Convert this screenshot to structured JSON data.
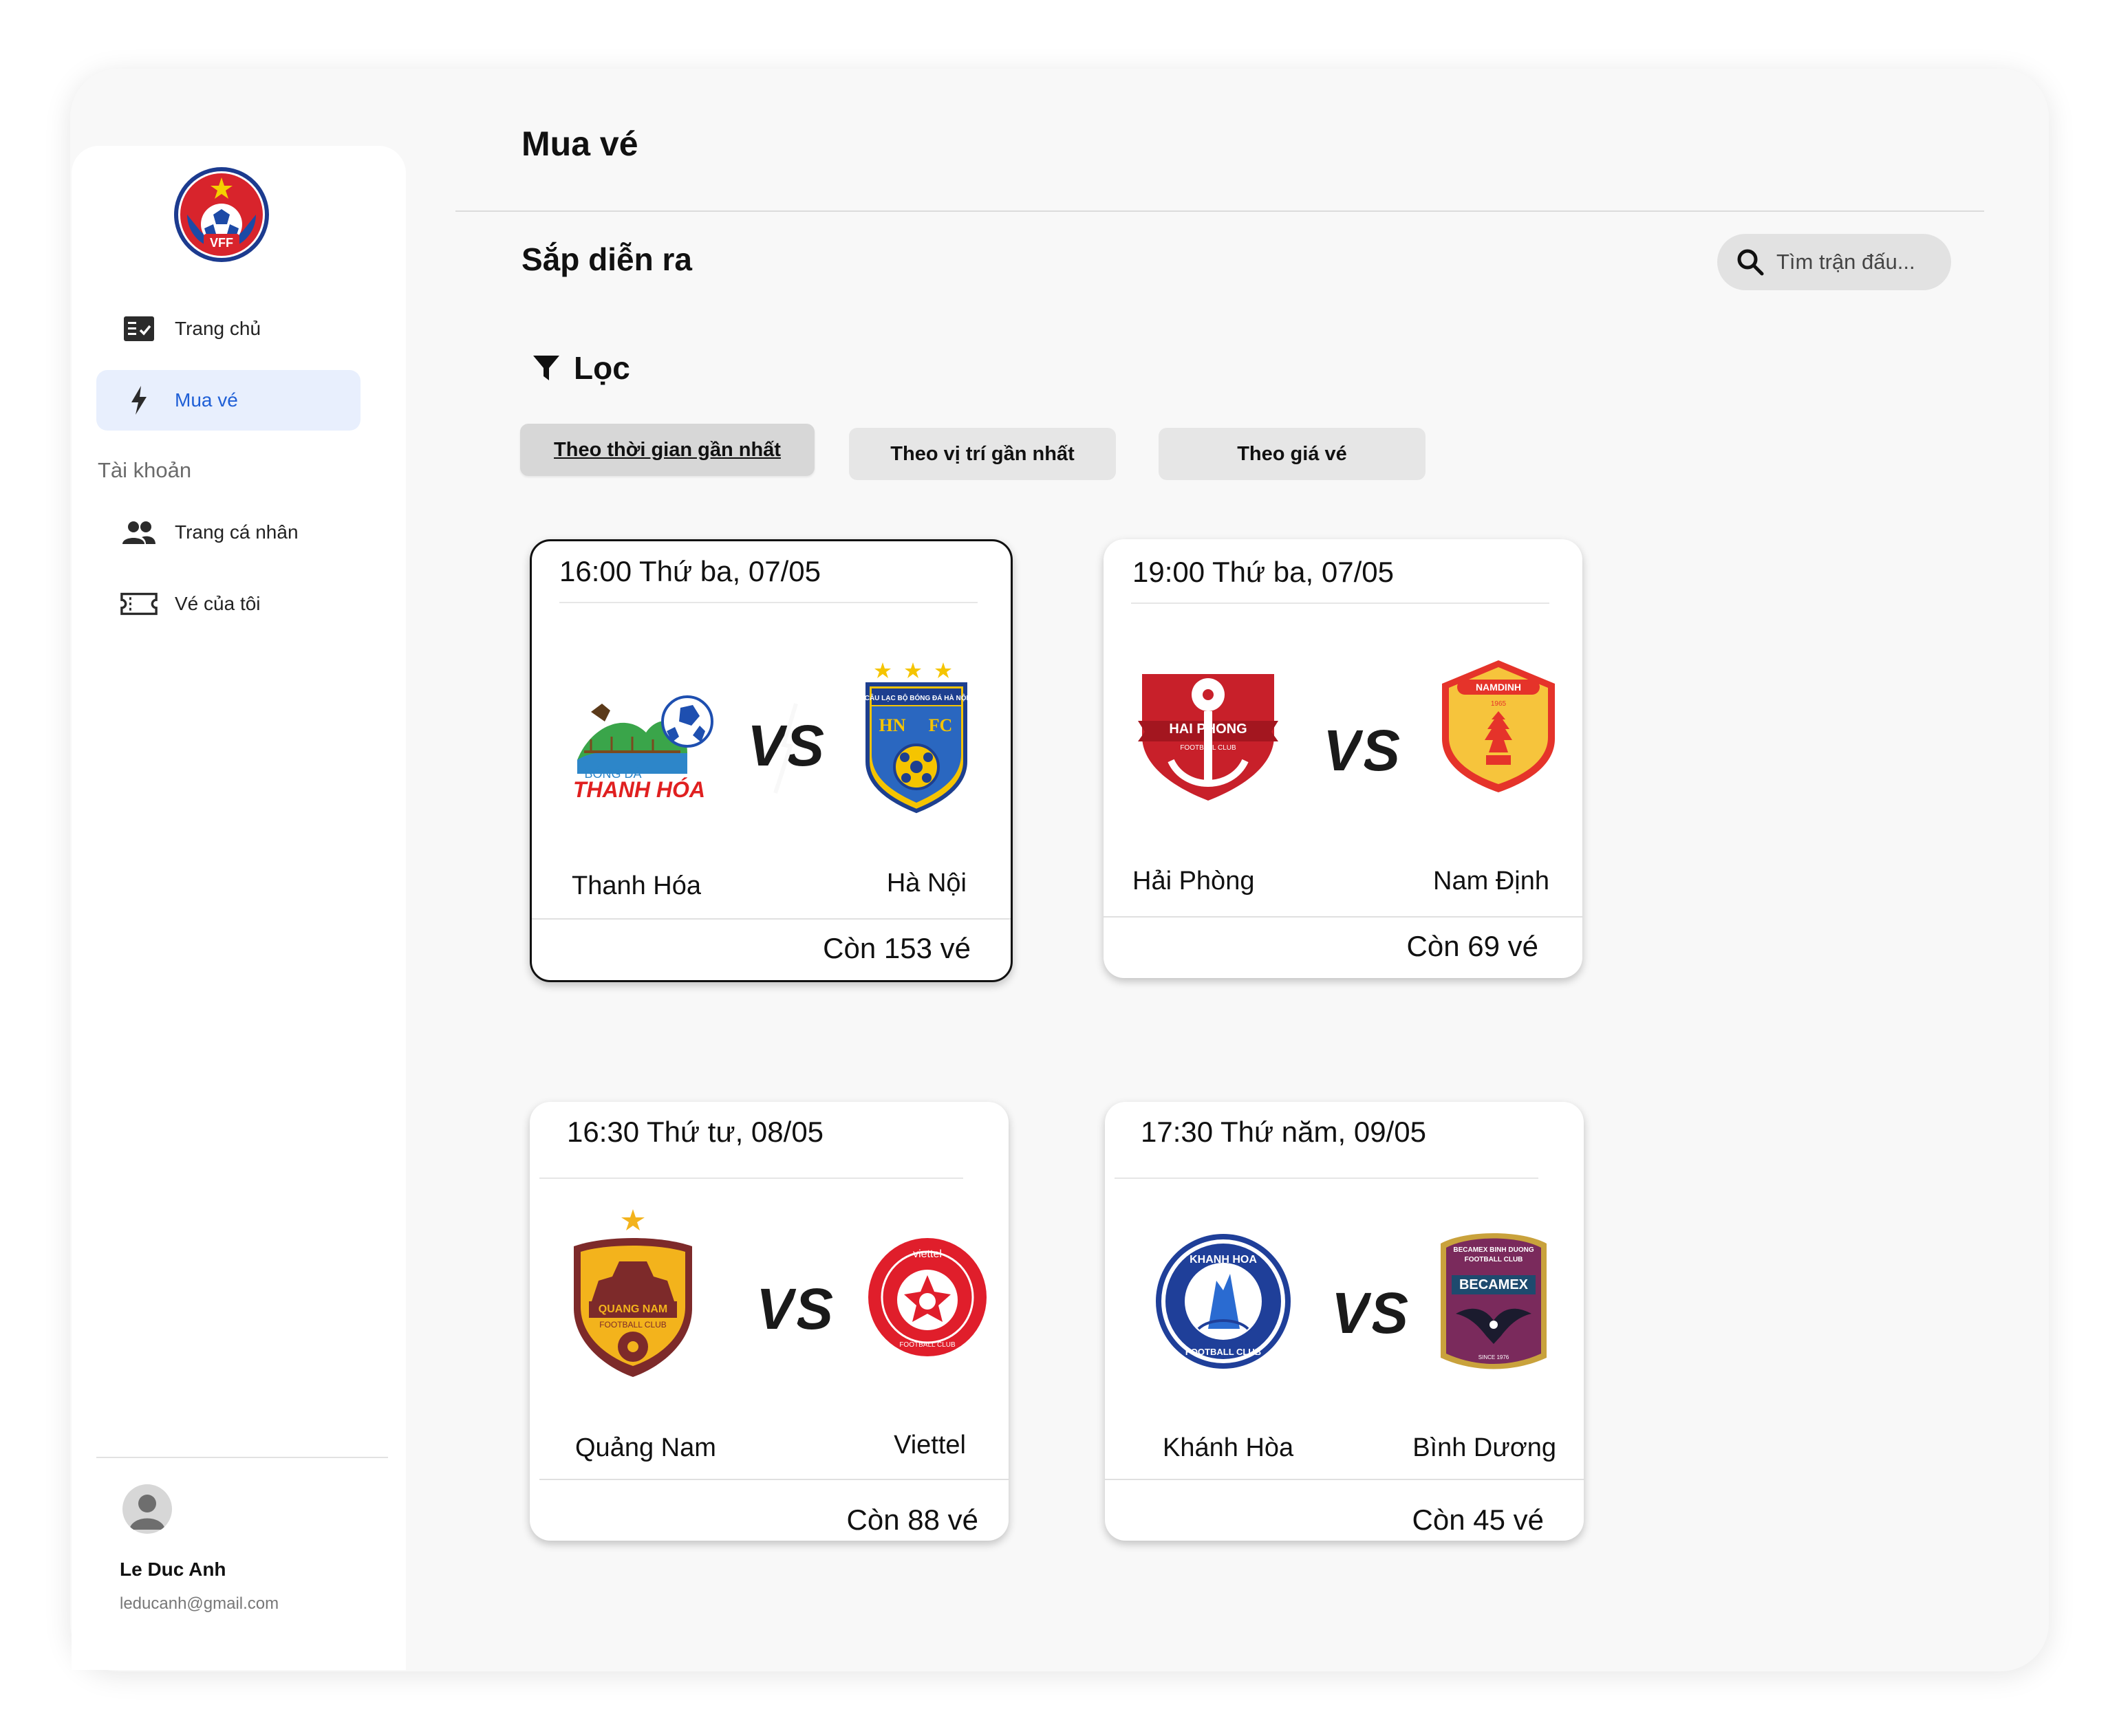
{
  "sidebar": {
    "nav": [
      {
        "label": "Trang chủ",
        "icon": "checklist-icon"
      },
      {
        "label": "Mua vé",
        "icon": "bolt-icon",
        "active": true
      }
    ],
    "account_section": "Tài khoản",
    "account_items": [
      {
        "label": "Trang cá nhân",
        "icon": "people-icon"
      },
      {
        "label": "Vé của tôi",
        "icon": "ticket-icon"
      }
    ],
    "logo_text": "VFF",
    "user": {
      "name": "Le Duc Anh",
      "email": "leducanh@gmail.com"
    }
  },
  "header": {
    "title": "Mua vé"
  },
  "main": {
    "subtitle": "Sắp diễn ra",
    "search": {
      "placeholder": "Tìm trận đấu..."
    },
    "filter": {
      "label": "Lọc",
      "options": [
        "Theo thời gian gần nhất",
        "Theo vị trí gần nhất",
        "Theo giá vé"
      ],
      "active_index": 0
    },
    "matches": [
      {
        "datetime": "16:00 Thứ ba, 07/05",
        "home": "Thanh Hóa",
        "away": "Hà Nội",
        "tickets": "Còn 153 vé",
        "selected": true,
        "home_logo_text": [
          "BÓNG ĐÁ",
          "THANH HÓA"
        ],
        "away_logo_text": [
          "CÂU LẠC BỘ BÓNG ĐÁ HÀ NỘI",
          "HN",
          "FC"
        ]
      },
      {
        "datetime": "19:00 Thứ ba, 07/05",
        "home": "Hải Phòng",
        "away": "Nam Định",
        "tickets": "Còn 69 vé",
        "selected": false,
        "home_logo_text": [
          "HAI PHONG",
          "FOOTBALL CLUB"
        ],
        "away_logo_text": [
          "NAMDINH",
          "1965"
        ]
      },
      {
        "datetime": "16:30 Thứ tư, 08/05",
        "home": "Quảng Nam",
        "away": "Viettel",
        "tickets": "Còn 88 vé",
        "selected": false,
        "home_logo_text": [
          "QUANG NAM",
          "FOOTBALL CLUB"
        ],
        "away_logo_text": [
          "viettel",
          "FOOTBALL CLUB"
        ]
      },
      {
        "datetime": "17:30 Thứ năm, 09/05",
        "home": "Khánh Hòa",
        "away": "Bình Dương",
        "tickets": "Còn 45 vé",
        "selected": false,
        "home_logo_text": [
          "KHANH HOA",
          "FOOTBALL CLUB"
        ],
        "away_logo_text": [
          "BECAMEX BINH DUONG",
          "FOOTBALL CLUB",
          "BECAMEX",
          "SINCE 1976"
        ]
      }
    ],
    "vs_text": "VS"
  }
}
